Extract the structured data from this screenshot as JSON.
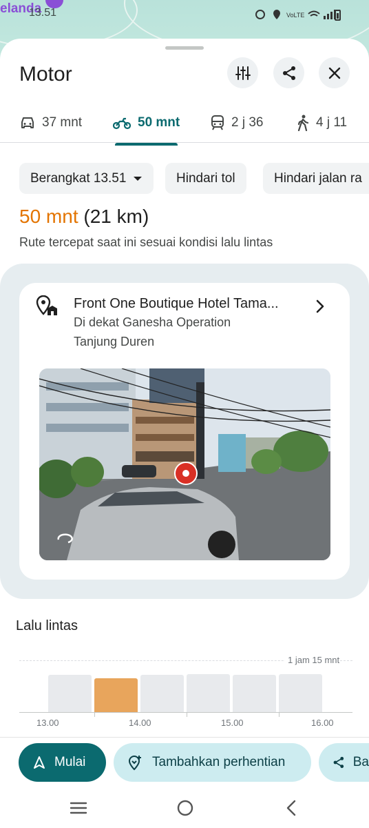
{
  "status_bar": {
    "map_place_label": "elanda",
    "time": "13.51"
  },
  "sheet": {
    "title": "Motor",
    "actions": {
      "filter": "tune-icon",
      "share": "share-icon",
      "close": "close-icon"
    }
  },
  "tabs": [
    {
      "label": "37 mnt",
      "icon": "car-icon"
    },
    {
      "label": "50 mnt",
      "icon": "motorbike-icon",
      "active": true
    },
    {
      "label": "2 j 36",
      "icon": "train-icon"
    },
    {
      "label": "4 j 11",
      "icon": "walk-icon"
    }
  ],
  "chips": {
    "depart": "Berangkat 13.51",
    "avoid_toll": "Hindari tol",
    "avoid_highway": "Hindari jalan ra"
  },
  "route": {
    "duration": "50 mnt",
    "distance": "(21 km)",
    "description": "Rute tercepat saat ini sesuai kondisi lalu lintas"
  },
  "destination": {
    "name": "Front One Boutique Hotel Tama...",
    "near": "Di dekat Ganesha Operation",
    "area": "Tanjung Duren"
  },
  "traffic": {
    "title": "Lalu lintas",
    "max_label": "1 jam 15 mnt",
    "ticks": [
      "13.00",
      "14.00",
      "15.00",
      "16.00"
    ]
  },
  "chart_data": {
    "type": "bar",
    "title": "Lalu lintas",
    "categories": [
      "13.00",
      "13.30",
      "14.00",
      "14.30",
      "15.00",
      "15.30"
    ],
    "values": [
      55,
      50,
      55,
      56,
      55,
      56
    ],
    "highlight_index": 1,
    "ymax_label": "1 jam 15 mnt"
  },
  "bottom_actions": {
    "start": "Mulai",
    "add_stop": "Tambahkan perhentian",
    "share": "Ba"
  },
  "colors": {
    "accent": "#0b6a6f",
    "duration": "#e37400",
    "bar_highlight": "#e8a55c"
  }
}
